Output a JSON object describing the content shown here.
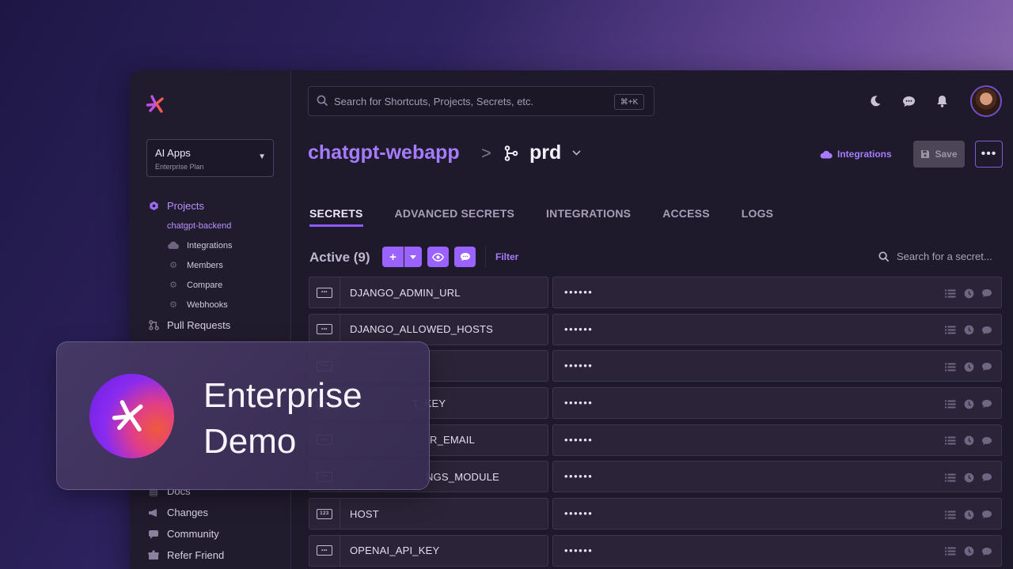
{
  "org": {
    "name": "AI Apps",
    "plan": "Enterprise Plan"
  },
  "sidebar": {
    "projects_label": "Projects",
    "current_project": "chatgpt-backend",
    "sub_items": [
      {
        "label": "Integrations",
        "icon": "cloud-icon"
      },
      {
        "label": "Members",
        "icon": "gear-icon"
      },
      {
        "label": "Compare",
        "icon": "gear-icon"
      },
      {
        "label": "Webhooks",
        "icon": "gear-icon"
      }
    ],
    "pull_requests": "Pull Requests",
    "bottom_items": [
      {
        "label": "Docs",
        "icon": "book-icon"
      },
      {
        "label": "Changes",
        "icon": "megaphone-icon"
      },
      {
        "label": "Community",
        "icon": "chat-icon"
      },
      {
        "label": "Refer Friend",
        "icon": "gift-icon"
      }
    ]
  },
  "search": {
    "placeholder": "Search for Shortcuts, Projects, Secrets, etc.",
    "shortcut": "⌘+K"
  },
  "breadcrumb": {
    "project": "chatgpt-webapp",
    "separator": ">",
    "environment": "prd"
  },
  "header": {
    "integrations": "Integrations",
    "save": "Save",
    "more": "•••"
  },
  "tabs": [
    {
      "label": "SECRETS",
      "active": true
    },
    {
      "label": "ADVANCED SECRETS",
      "active": false
    },
    {
      "label": "INTEGRATIONS",
      "active": false
    },
    {
      "label": "ACCESS",
      "active": false
    },
    {
      "label": "LOGS",
      "active": false
    }
  ],
  "toolbar": {
    "active_label": "Active (9)",
    "add": "+",
    "filter": "Filter",
    "search_placeholder": "Search for a secret..."
  },
  "secrets": [
    {
      "name": "DJANGO_ADMIN_URL",
      "type": "string",
      "value": "••••••"
    },
    {
      "name": "DJANGO_ALLOWED_HOSTS",
      "type": "string",
      "value": "••••••"
    },
    {
      "name": "",
      "type": "string",
      "value": "••••••"
    },
    {
      "name": "T_KEY",
      "type": "string",
      "value": "••••••"
    },
    {
      "name": "R_EMAIL",
      "type": "string",
      "value": "••••••"
    },
    {
      "name": "NGS_MODULE",
      "type": "string",
      "value": "••••••"
    },
    {
      "name": "HOST",
      "type": "number",
      "value": "••••••"
    },
    {
      "name": "OPENAI_API_KEY",
      "type": "string",
      "value": "••••••"
    }
  ],
  "overlay": {
    "line1": "Enterprise",
    "line2": "Demo"
  },
  "colors": {
    "accent": "#9a62ff",
    "link": "#a67cff",
    "background": "#1f1a2b"
  }
}
